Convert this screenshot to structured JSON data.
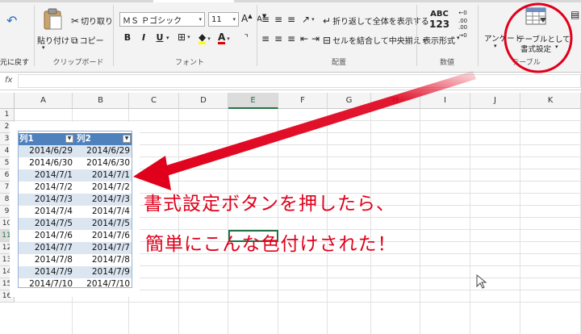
{
  "ribbon": {
    "undo_label": "元に戻す",
    "clipboard": {
      "paste": "貼り付け",
      "cut": "切り取り",
      "copy": "コピー",
      "group": "クリップボード"
    },
    "font": {
      "name": "ＭＳ Ｐゴシック",
      "size": "11",
      "group": "フォント",
      "bold": "B",
      "italic": "I",
      "underline": "U"
    },
    "alignment": {
      "wrap": "折り返して全体を表示する",
      "merge": "セルを結合して中央揃え",
      "group": "配置"
    },
    "number": {
      "badge": "ABC\n123",
      "format": "表示形式",
      "group": "数値"
    },
    "styles": {
      "conditional": "アンケート",
      "table_line1": "テーブルとして",
      "table_line2": "書式設定",
      "group": "テーブル"
    }
  },
  "formula_bar": {
    "fx": "fx"
  },
  "columns": [
    "A",
    "B",
    "C",
    "D",
    "E",
    "F",
    "G",
    "H",
    "I",
    "J",
    "K"
  ],
  "rows": [
    "1",
    "2",
    "3",
    "4",
    "5",
    "6",
    "7",
    "8",
    "9",
    "10",
    "11",
    "12",
    "13",
    "14",
    "15",
    "16"
  ],
  "table": {
    "headers": [
      "列1",
      "列2"
    ],
    "rows": [
      [
        "2014/6/29",
        "2014/6/29"
      ],
      [
        "2014/6/30",
        "2014/6/30"
      ],
      [
        "2014/7/1",
        "2014/7/1"
      ],
      [
        "2014/7/2",
        "2014/7/2"
      ],
      [
        "2014/7/3",
        "2014/7/3"
      ],
      [
        "2014/7/4",
        "2014/7/4"
      ],
      [
        "2014/7/5",
        "2014/7/5"
      ],
      [
        "2014/7/6",
        "2014/7/6"
      ],
      [
        "2014/7/7",
        "2014/7/7"
      ],
      [
        "2014/7/8",
        "2014/7/8"
      ],
      [
        "2014/7/9",
        "2014/7/9"
      ],
      [
        "2014/7/10",
        "2014/7/10"
      ]
    ]
  },
  "annotation": {
    "line1": "書式設定ボタンを押したら、",
    "line2": "簡単にこんな色付けされた！"
  },
  "colors": {
    "header": "#4f81bd",
    "band": "#dce6f1",
    "annotation": "#e0001b",
    "excel_green": "#217346"
  }
}
